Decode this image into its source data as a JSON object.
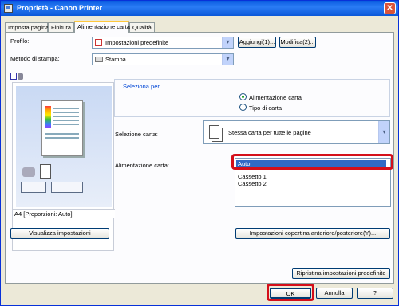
{
  "window": {
    "title": "Proprietà - Canon Printer",
    "close_label": "✕"
  },
  "tabs": [
    {
      "label": "Imposta pagina",
      "active": false
    },
    {
      "label": "Finitura",
      "active": false
    },
    {
      "label": "Alimentazione carta",
      "active": true
    },
    {
      "label": "Qualità",
      "active": false
    }
  ],
  "profile": {
    "label": "Profilo:",
    "value": "Impostazioni predefinite",
    "add_label": "Aggiungi(1)...",
    "edit_label": "Modifica(2)..."
  },
  "output": {
    "label": "Metodo di stampa:",
    "value": "Stampa"
  },
  "preview": {
    "caption": "A4 [Proporzioni: Auto]"
  },
  "select_by": {
    "label": "Seleziona per",
    "option_feed": "Alimentazione carta",
    "option_type": "Tipo di carta",
    "selected": "Alimentazione carta"
  },
  "paper_select": {
    "label": "Selezione carta:",
    "value": "Stessa carta per tutte le pagine"
  },
  "paper_source": {
    "label": "Alimentazione carta:",
    "items": [
      "Auto",
      "Cassetto 1",
      "Cassetto 2"
    ],
    "selected": "Auto"
  },
  "buttons": {
    "view_settings": "Visualizza impostazioni",
    "cover_settings": "Impostazioni copertina anteriore/posteriore(Y)...",
    "restore_defaults": "Ripristina impostazioni predefinite",
    "ok": "OK",
    "cancel": "Annulla",
    "help": "?"
  },
  "colors": {
    "titlebar": "#0a5be0",
    "highlight": "#d40f1a",
    "selection": "#316ac5"
  }
}
